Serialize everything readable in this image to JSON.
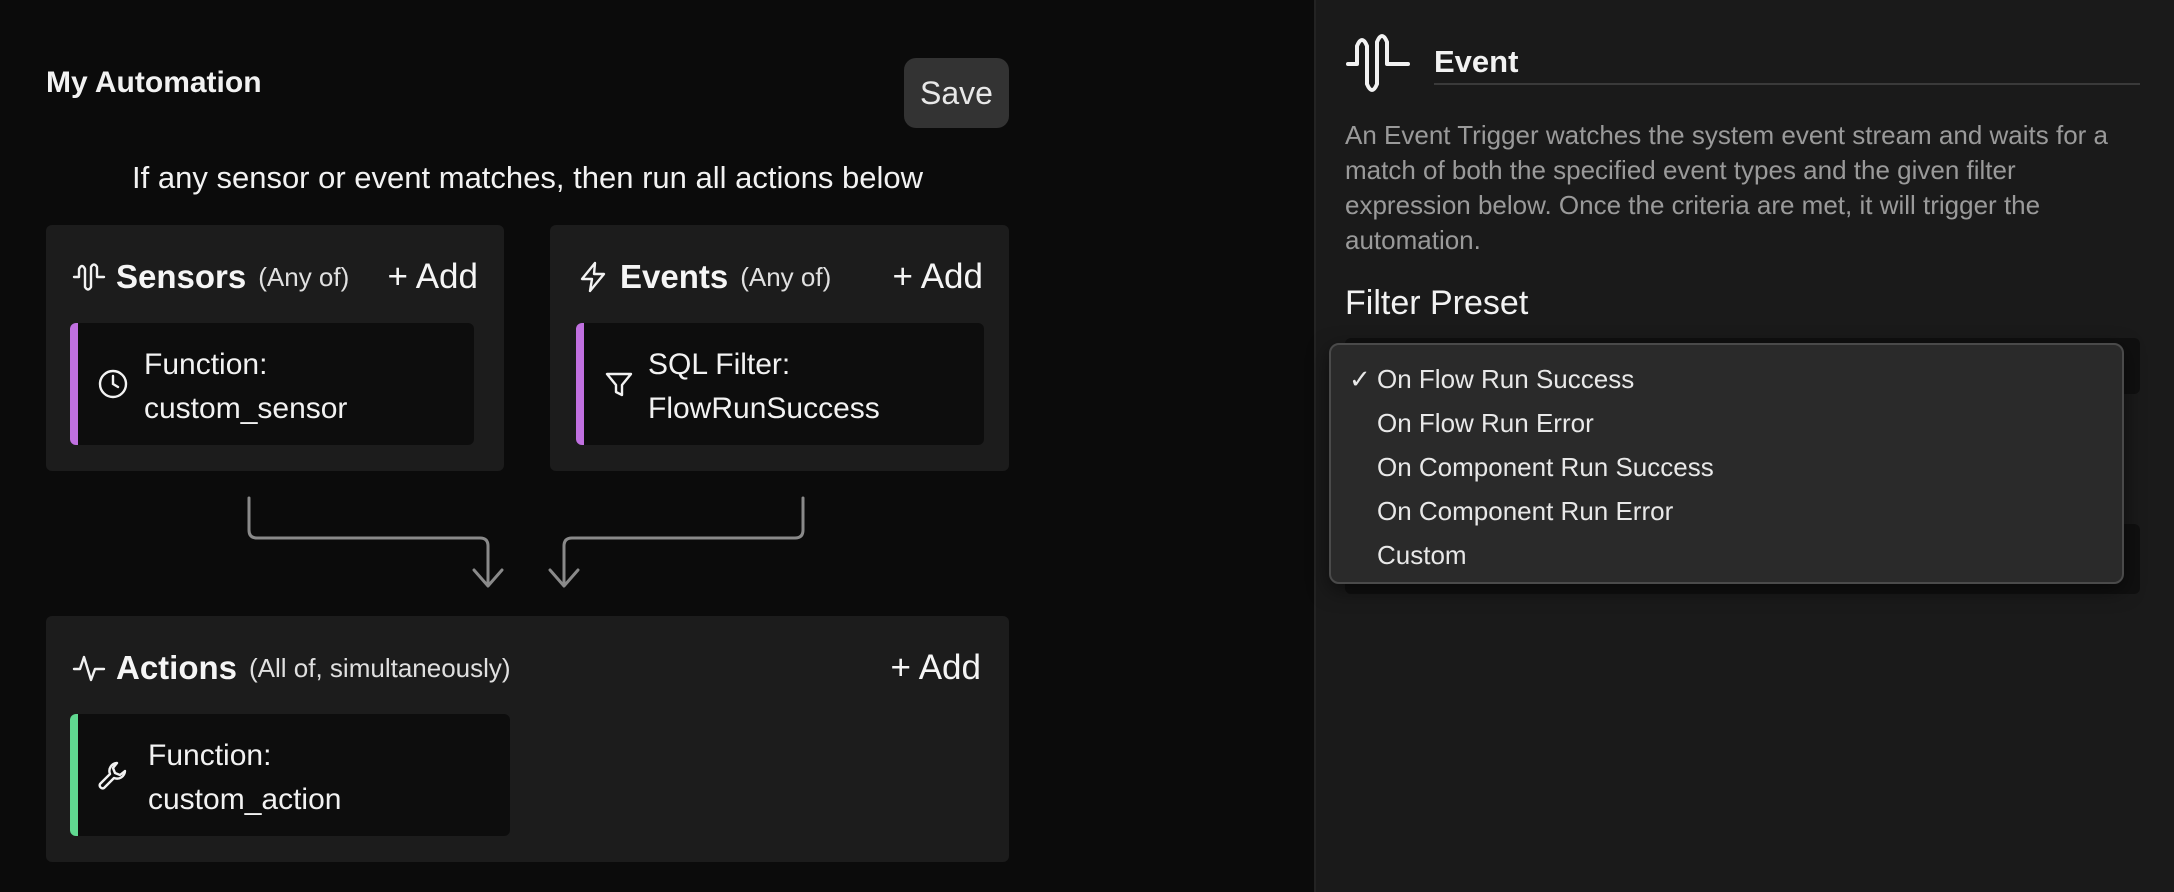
{
  "header": {
    "title": "My Automation",
    "save_label": "Save",
    "rule_text": "If any sensor or event matches, then run all actions below"
  },
  "sensors": {
    "title": "Sensors",
    "subtitle": "(Any of)",
    "add_label": "+ Add",
    "icon": "waveform-icon",
    "items": [
      {
        "line1": "Function:",
        "line2": "custom_sensor",
        "icon": "clock-icon",
        "accent": "#c070e0"
      }
    ]
  },
  "events": {
    "title": "Events",
    "subtitle": "(Any of)",
    "add_label": "+ Add",
    "icon": "lightning-icon",
    "items": [
      {
        "line1": "SQL Filter:",
        "line2": "FlowRunSuccess",
        "icon": "filter-icon",
        "accent": "#c070e0"
      }
    ]
  },
  "actions": {
    "title": "Actions",
    "subtitle": "(All of, simultaneously)",
    "add_label": "+ Add",
    "icon": "activity-icon",
    "items": [
      {
        "line1": "Function:",
        "line2": "custom_action",
        "icon": "wrench-icon",
        "accent": "#60d890"
      }
    ]
  },
  "event_panel": {
    "title": "Event",
    "icon": "waveform-icon",
    "description": "An Event Trigger watches the system event stream and waits for a match of both the specified event types and the given filter expression below. Once the criteria are met, it will trigger the automation.",
    "filter_preset_label": "Filter Preset",
    "dropdown": {
      "selected": "On Flow Run Success",
      "check_mark": "✓",
      "options": [
        "On Flow Run Success",
        "On Flow Run Error",
        "On Component Run Success",
        "On Component Run Error",
        "Custom"
      ]
    }
  },
  "colors": {
    "accent_purple": "#c070e0",
    "accent_green": "#60d890",
    "background": "#0b0b0b",
    "panel": "#1c1c1c"
  }
}
